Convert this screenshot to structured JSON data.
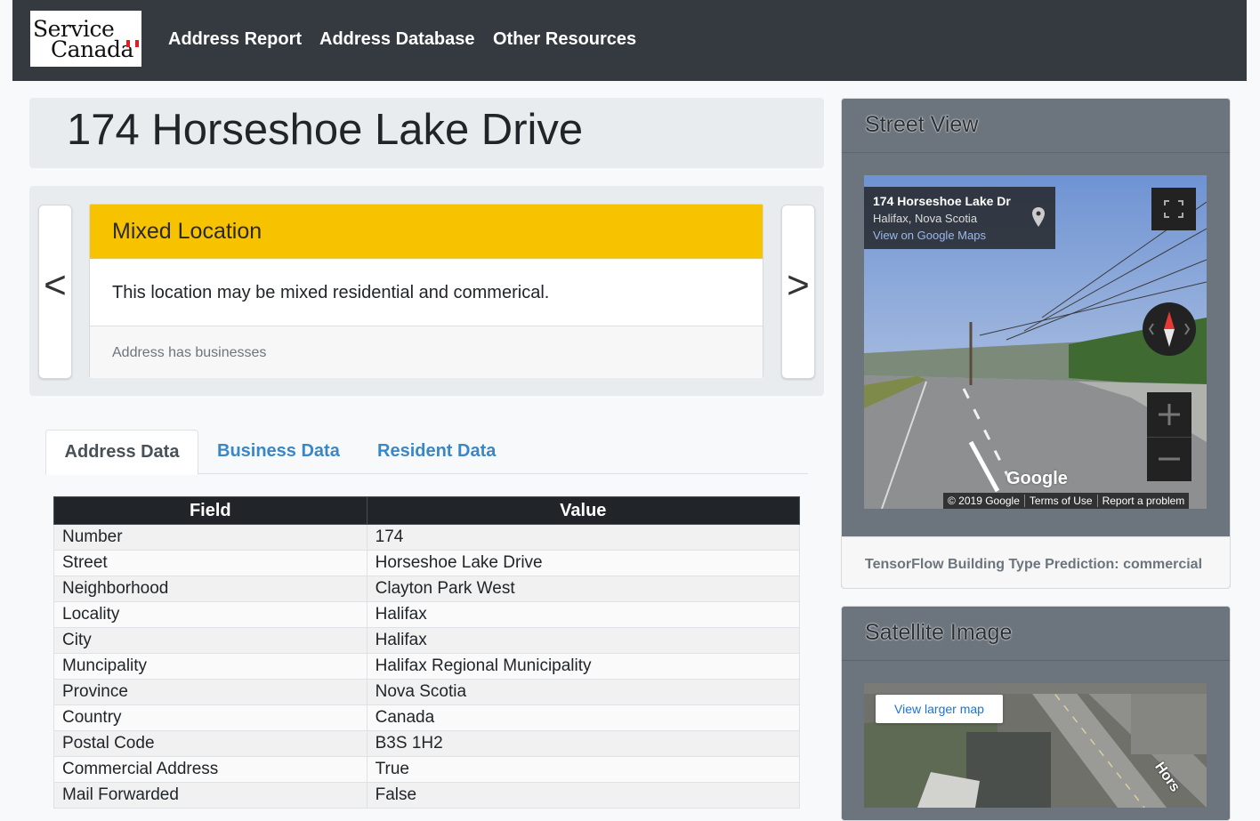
{
  "brand": {
    "line1": "Service",
    "line2": "Canada"
  },
  "nav": {
    "items": [
      "Address Report",
      "Address Database",
      "Other Resources"
    ]
  },
  "page_title": "174 Horseshoe Lake Drive",
  "carousel": {
    "prev": "<",
    "next": ">",
    "card": {
      "header": "Mixed Location",
      "body": "This location may be mixed residential and commerical.",
      "footer": "Address has businesses",
      "header_color": "#f7c200"
    }
  },
  "tabs": [
    {
      "label": "Address Data",
      "active": true
    },
    {
      "label": "Business Data",
      "active": false
    },
    {
      "label": "Resident Data",
      "active": false
    }
  ],
  "table": {
    "headers": [
      "Field",
      "Value"
    ],
    "rows": [
      [
        "Number",
        "174"
      ],
      [
        "Street",
        "Horseshoe Lake Drive"
      ],
      [
        "Neighborhood",
        "Clayton Park West"
      ],
      [
        "Locality",
        "Halifax"
      ],
      [
        "City",
        "Halifax"
      ],
      [
        "Muncipality",
        "Halifax Regional Municipality"
      ],
      [
        "Province",
        "Nova Scotia"
      ],
      [
        "Country",
        "Canada"
      ],
      [
        "Postal Code",
        "B3S 1H2"
      ],
      [
        "Commercial Address",
        "True"
      ],
      [
        "Mail Forwarded",
        "False"
      ]
    ]
  },
  "street_view": {
    "title": "Street View",
    "info": {
      "address": "174 Horseshoe Lake Dr",
      "city": "Halifax, Nova Scotia",
      "link": "View on Google Maps"
    },
    "google": "Google",
    "attribution": [
      "© 2019 Google",
      "Terms of Use",
      "Report a problem"
    ],
    "prediction": "TensorFlow Building Type Prediction: commercial"
  },
  "satellite": {
    "title": "Satellite Image",
    "button": "View larger map",
    "road_label": "Hors"
  }
}
